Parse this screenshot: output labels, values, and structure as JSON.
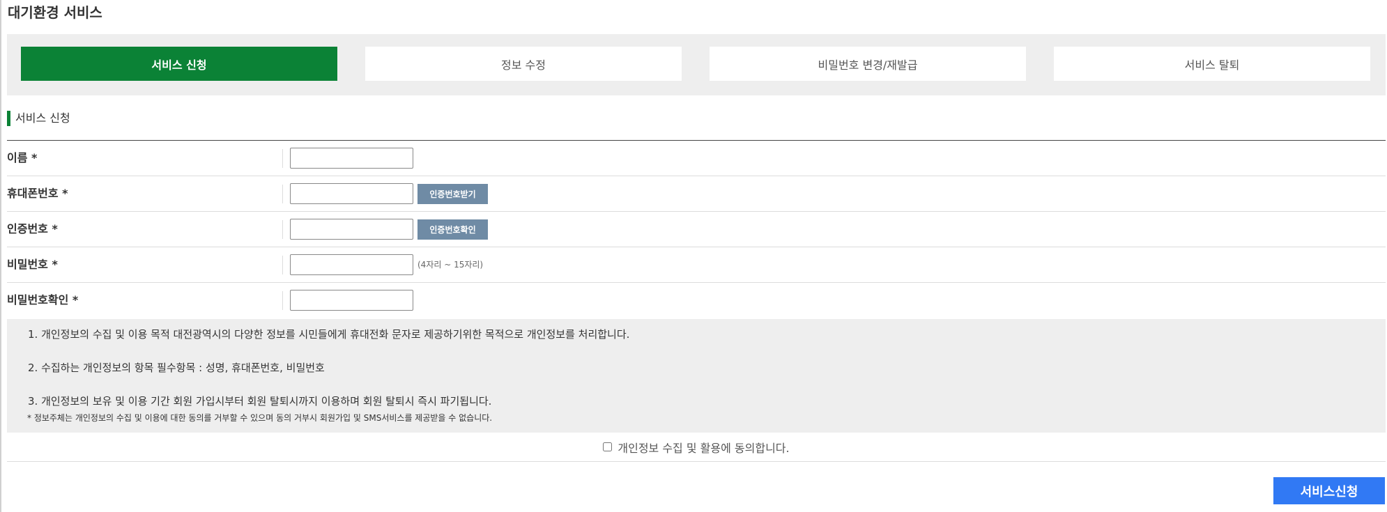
{
  "page": {
    "title": "대기환경 서비스"
  },
  "tabs": [
    {
      "label": "서비스 신청",
      "active": true
    },
    {
      "label": "정보 수정",
      "active": false
    },
    {
      "label": "비밀번호 변경/재발급",
      "active": false
    },
    {
      "label": "서비스 탈퇴",
      "active": false
    }
  ],
  "section": {
    "title": "서비스 신청"
  },
  "form": {
    "name": {
      "label": "이름 *",
      "value": ""
    },
    "phone": {
      "label": "휴대폰번호 *",
      "value": "",
      "button": "인증번호받기"
    },
    "auth_code": {
      "label": "인증번호 *",
      "value": "",
      "button": "인증번호확인"
    },
    "password": {
      "label": "비밀번호 *",
      "value": "",
      "hint": "(4자리 ~ 15자리)"
    },
    "password_confirm": {
      "label": "비밀번호확인 *",
      "value": ""
    }
  },
  "notice": {
    "line1": "1. 개인정보의 수집 및 이용 목적 대전광역시의 다양한 정보를 시민들에게 휴대전화 문자로 제공하기위한 목적으로 개인정보를 처리합니다.",
    "line2": "2. 수집하는 개인정보의 항목 필수항목 : 성명, 휴대폰번호, 비밀번호",
    "line3": "3. 개인정보의 보유 및 이용 기간 회원 가입시부터 회원 탈퇴시까지 이용하며 회원 탈퇴시 즉시 파기됩니다.",
    "footnote": "* 정보주체는 개인정보의 수집 및 이용에 대한 동의를 거부할 수 있으며 동의 거부시 회원가입 및 SMS서비스를 제공받을 수 없습니다."
  },
  "consent": {
    "label": "개인정보 수집 및 활용에 동의합니다.",
    "checked": false
  },
  "submit": {
    "label": "서비스신청"
  },
  "colors": {
    "accent_green": "#0b8236",
    "button_gray_blue": "#6f8ba5",
    "submit_blue": "#3179f4"
  }
}
